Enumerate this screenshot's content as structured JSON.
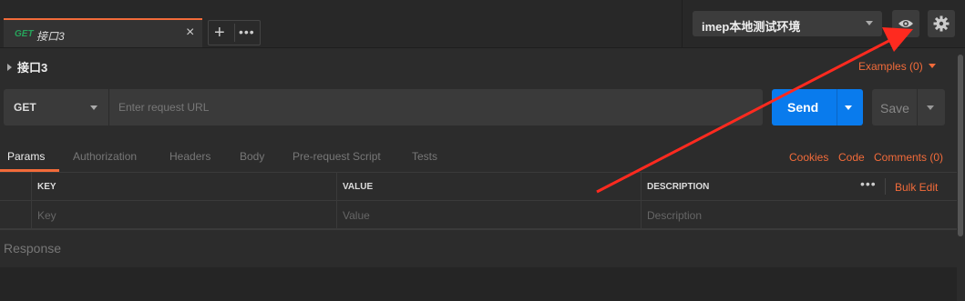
{
  "tab": {
    "method": "GET",
    "title": "接口3",
    "close": "×"
  },
  "tab_buttons": {
    "add": "+",
    "more": "•••"
  },
  "environment": {
    "selected": "imep本地测试环境"
  },
  "request": {
    "title": "接口3",
    "examples_label": "Examples (0)",
    "method": "GET",
    "url_placeholder": "Enter request URL",
    "send_label": "Send",
    "save_label": "Save"
  },
  "subtabs": [
    "Params",
    "Authorization",
    "Headers",
    "Body",
    "Pre-request Script",
    "Tests"
  ],
  "right_links": [
    "Cookies",
    "Code",
    "Comments (0)"
  ],
  "params_table": {
    "headers": [
      "KEY",
      "VALUE",
      "DESCRIPTION"
    ],
    "placeholders": [
      "Key",
      "Value",
      "Description"
    ],
    "more": "•••",
    "bulk_edit": "Bulk Edit"
  },
  "response": {
    "label": "Response"
  },
  "colors": {
    "accent": "#f26b3a",
    "send": "#097bed",
    "method_get": "#27a35b",
    "annotation": "#ff2a1f"
  },
  "icons": [
    "eye-icon",
    "gear-icon",
    "close-icon",
    "plus-icon",
    "chevron-down-icon",
    "triangle-right-icon"
  ]
}
